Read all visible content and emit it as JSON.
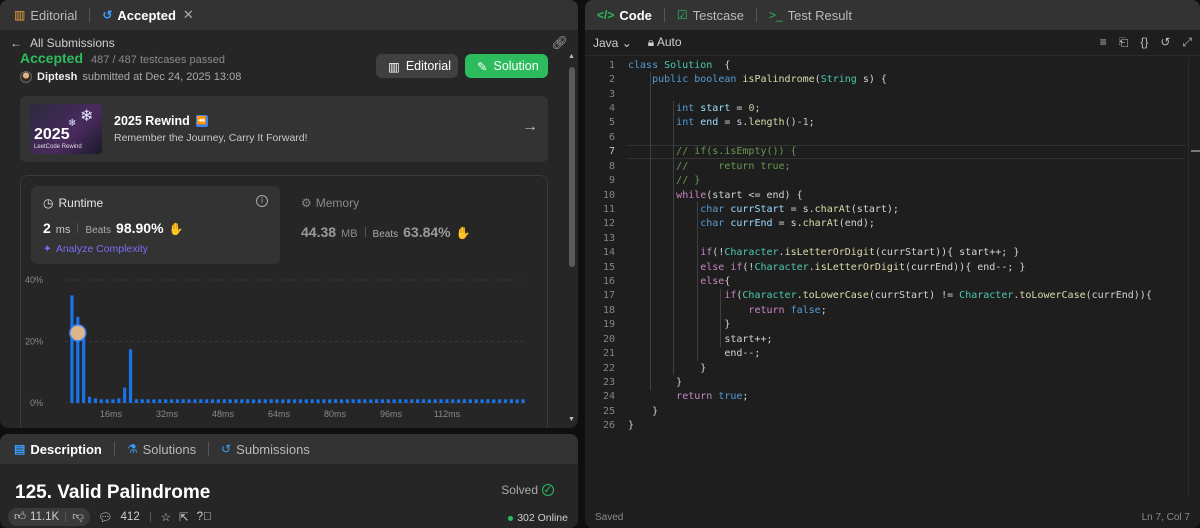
{
  "left_top": {
    "tabs": [
      {
        "label": "Editorial",
        "icon": "book-icon"
      },
      {
        "label": "Accepted",
        "icon": "history-icon"
      }
    ],
    "back_label": "All Submissions",
    "status": "Accepted",
    "testcases": "487 / 487 testcases passed",
    "submitter_name": "Diptesh",
    "submitted_text": "submitted at Dec 24, 2025 13:08",
    "editorial_btn": "Editorial",
    "solution_btn": "Solution",
    "rewind": {
      "year": "2025",
      "img_sub": "LeetCode Rewind",
      "title": "2025 Rewind",
      "badge": "⏪",
      "subtitle": "Remember the Journey, Carry It Forward!"
    },
    "runtime": {
      "title": "Runtime",
      "value": "2",
      "unit": "ms",
      "beats_label": "Beats",
      "beats_pct": "98.90%",
      "analyze": "Analyze Complexity"
    },
    "memory": {
      "title": "Memory",
      "value": "44.38",
      "unit": "MB",
      "beats_label": "Beats",
      "beats_pct": "63.84%"
    }
  },
  "chart_data": {
    "type": "bar",
    "y_ticks": [
      "40%",
      "20%",
      "0%"
    ],
    "x_ticks": [
      "16ms",
      "32ms",
      "48ms",
      "64ms",
      "80ms",
      "96ms",
      "112ms"
    ],
    "ylim": [
      0,
      40
    ],
    "values": [
      35,
      28,
      22,
      2,
      1.5,
      1.2,
      1.2,
      1.2,
      1.5,
      5,
      17.5,
      1.2,
      1.2,
      1.2,
      1.2,
      1.2,
      1.2,
      1.2,
      1.2,
      1.2,
      1.2,
      1.2,
      1.2,
      1.2,
      1.2,
      1.2,
      1.2,
      1.2,
      1.2,
      1.2,
      1.2,
      1.2,
      1.2,
      1.2,
      1.2,
      1.2,
      1.2,
      1.2,
      1.2,
      1.2,
      1.2,
      1.2,
      1.2,
      1.2,
      1.2,
      1.2,
      1.2,
      1.2,
      1.2,
      1.2,
      1.2,
      1.2,
      1.2,
      1.2,
      1.2,
      1.2,
      1.2,
      1.2,
      1.2,
      1.2,
      1.2,
      1.2,
      1.2,
      1.2,
      1.2,
      1.2,
      1.2,
      1.2,
      1.2,
      1.2,
      1.2,
      1.2,
      1.2,
      1.2,
      1.2,
      1.2,
      1.2,
      1.2
    ],
    "bar_color": "#1a73e8",
    "marker_index": 1
  },
  "left_bottom": {
    "tabs": [
      {
        "label": "Description",
        "icon": "doc-icon"
      },
      {
        "label": "Solutions",
        "icon": "flask-icon"
      },
      {
        "label": "Submissions",
        "icon": "history-icon"
      }
    ],
    "title": "125. Valid Palindrome",
    "solved": "Solved",
    "likes": "11.1K",
    "comments": "412",
    "online": "302 Online"
  },
  "right": {
    "tabs": [
      {
        "label": "Code",
        "icon": "code-icon"
      },
      {
        "label": "Testcase",
        "icon": "check-box-icon"
      },
      {
        "label": "Test Result",
        "icon": "terminal-icon"
      }
    ],
    "language": "Java",
    "mode": "Auto",
    "status_left": "Saved",
    "status_right": "Ln 7, Col 7",
    "code": [
      [
        [
          "kw",
          "class "
        ],
        [
          "ty",
          "Solution"
        ],
        [
          "",
          "  {"
        ]
      ],
      [
        [
          "",
          "    "
        ],
        [
          "kw",
          "public boolean "
        ],
        [
          "fn",
          "isPalindrome"
        ],
        [
          "",
          "("
        ],
        [
          "ty",
          "String"
        ],
        [
          "",
          " s) {"
        ]
      ],
      [
        [
          "",
          ""
        ]
      ],
      [
        [
          "",
          "        "
        ],
        [
          "kw",
          "int "
        ],
        [
          "vr",
          "start"
        ],
        [
          "",
          " = "
        ],
        [
          "num",
          "0"
        ],
        [
          "",
          ";"
        ]
      ],
      [
        [
          "",
          "        "
        ],
        [
          "kw",
          "int "
        ],
        [
          "vr",
          "end"
        ],
        [
          "",
          " = s."
        ],
        [
          "fn",
          "length"
        ],
        [
          "",
          "()-"
        ],
        [
          "num",
          "1"
        ],
        [
          "",
          ";"
        ]
      ],
      [
        [
          "",
          ""
        ]
      ],
      [
        [
          "",
          "        "
        ],
        [
          "cm",
          "// if(s.isEmpty()) {"
        ]
      ],
      [
        [
          "",
          "        "
        ],
        [
          "cm",
          "//     return true;"
        ]
      ],
      [
        [
          "",
          "        "
        ],
        [
          "cm",
          "// }"
        ]
      ],
      [
        [
          "",
          "        "
        ],
        [
          "kw2",
          "while"
        ],
        [
          "",
          "(start <= end) {"
        ]
      ],
      [
        [
          "",
          "            "
        ],
        [
          "kw",
          "char "
        ],
        [
          "vr",
          "currStart"
        ],
        [
          "",
          " = s."
        ],
        [
          "fn",
          "charAt"
        ],
        [
          "",
          "(start);"
        ]
      ],
      [
        [
          "",
          "            "
        ],
        [
          "kw",
          "char "
        ],
        [
          "vr",
          "currEnd"
        ],
        [
          "",
          " = s."
        ],
        [
          "fn",
          "charAt"
        ],
        [
          "",
          "(end);"
        ]
      ],
      [
        [
          "",
          ""
        ]
      ],
      [
        [
          "",
          "            "
        ],
        [
          "kw2",
          "if"
        ],
        [
          "",
          "(!"
        ],
        [
          "ty",
          "Character"
        ],
        [
          "",
          "."
        ],
        [
          "fn",
          "isLetterOrDigit"
        ],
        [
          "",
          "(currStart)){ start++; }"
        ]
      ],
      [
        [
          "",
          "            "
        ],
        [
          "kw2",
          "else if"
        ],
        [
          "",
          "(!"
        ],
        [
          "ty",
          "Character"
        ],
        [
          "",
          "."
        ],
        [
          "fn",
          "isLetterOrDigit"
        ],
        [
          "",
          "(currEnd)){ end--; }"
        ]
      ],
      [
        [
          "",
          "            "
        ],
        [
          "kw2",
          "else"
        ],
        [
          "",
          "{"
        ]
      ],
      [
        [
          "",
          "                "
        ],
        [
          "kw2",
          "if"
        ],
        [
          "",
          "("
        ],
        [
          "ty",
          "Character"
        ],
        [
          "",
          "."
        ],
        [
          "fn",
          "toLowerCase"
        ],
        [
          "",
          "(currStart) != "
        ],
        [
          "ty",
          "Character"
        ],
        [
          "",
          "."
        ],
        [
          "fn",
          "toLowerCase"
        ],
        [
          "",
          "(currEnd)){"
        ]
      ],
      [
        [
          "",
          "                    "
        ],
        [
          "kw2",
          "return "
        ],
        [
          "kw",
          "false"
        ],
        [
          "",
          ";"
        ]
      ],
      [
        [
          "",
          "                }"
        ]
      ],
      [
        [
          "",
          "                start++;"
        ]
      ],
      [
        [
          "",
          "                end--;"
        ]
      ],
      [
        [
          "",
          "            }"
        ]
      ],
      [
        [
          "",
          "        }"
        ]
      ],
      [
        [
          "",
          "        "
        ],
        [
          "kw2",
          "return "
        ],
        [
          "kw",
          "true"
        ],
        [
          "",
          ";"
        ]
      ],
      [
        [
          "",
          "    }"
        ]
      ],
      [
        [
          "",
          "}"
        ]
      ]
    ]
  }
}
